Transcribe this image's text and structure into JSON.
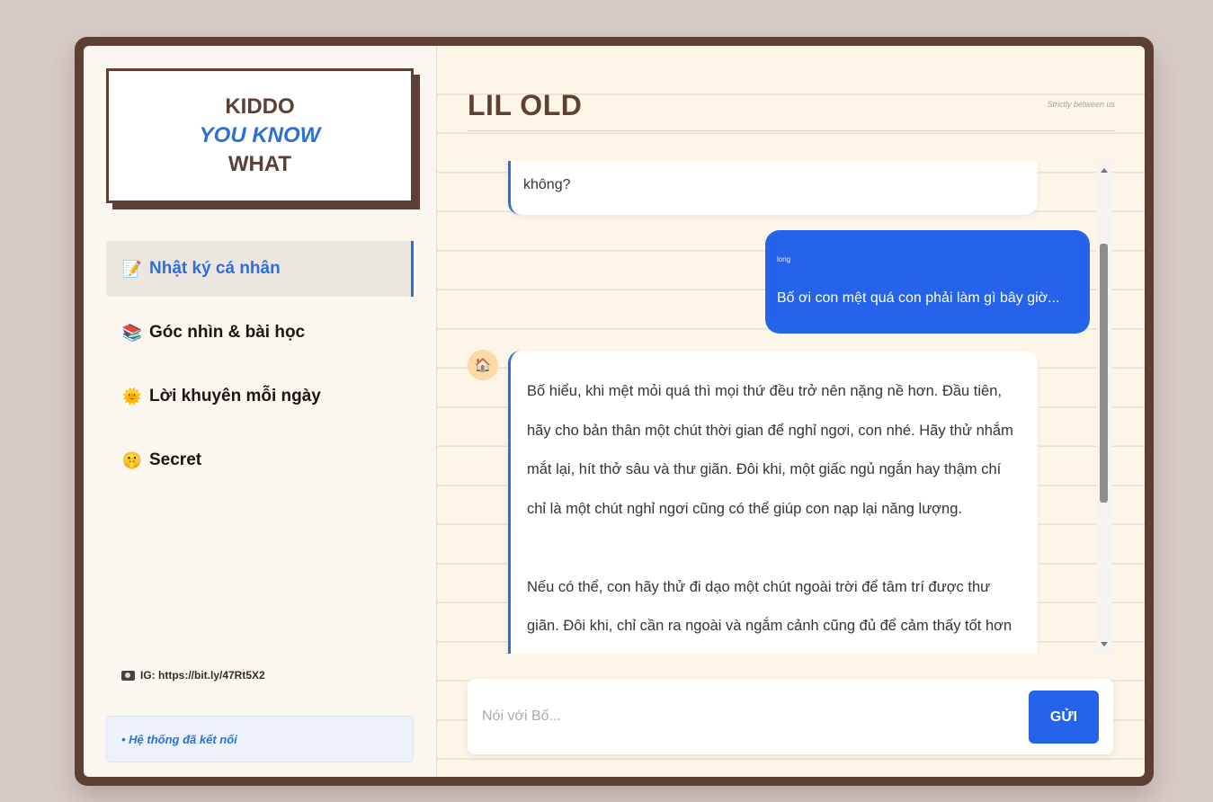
{
  "brand": {
    "line1": "KIDDO",
    "line2": "YOU KNOW",
    "line3": "WHAT"
  },
  "sidebar": {
    "items": [
      {
        "label": "Nhật ký cá nhân",
        "icon": "📝",
        "active": true
      },
      {
        "label": "Góc nhìn & bài học",
        "icon": "📚",
        "active": false
      },
      {
        "label": "Lời khuyên mỗi ngày",
        "icon": "🌞",
        "active": false
      },
      {
        "label": "Secret",
        "icon": "🤫",
        "active": false
      }
    ],
    "ig_label": "IG: https://bit.ly/47Rt5X2",
    "status": "• Hệ thống đã kết nối"
  },
  "header": {
    "title": "LIL OLD",
    "subtitle": "Strictly between us"
  },
  "chat": {
    "messages": [
      {
        "role": "bot",
        "text": "không?"
      },
      {
        "role": "user",
        "meta": "long",
        "text": "Bố ơi con mệt quá con phải làm gì bây giờ..."
      },
      {
        "role": "bot",
        "avatar": "🏠",
        "paragraphs": [
          "Bố hiểu, khi mệt mỏi quá thì mọi thứ đều trở nên nặng nề hơn. Đầu tiên, hãy cho bản thân một chút thời gian để nghỉ ngơi, con nhé. Hãy thử nhắm mắt lại, hít thở sâu và thư giãn. Đôi khi, một giấc ngủ ngắn hay thậm chí chỉ là một chút nghỉ ngơi cũng có thể giúp con nạp lại năng lượng.",
          "Nếu có thể, con hãy thử đi dạo một chút ngoài trời để tâm trí được thư giãn. Đôi khi, chỉ cần ra ngoài và ngắm cảnh cũng đủ để cảm thấy tốt hơn rồi."
        ]
      }
    ]
  },
  "composer": {
    "placeholder": "Nói với Bố...",
    "send_label": "GỬI"
  },
  "colors": {
    "brand_brown": "#5e3f34",
    "accent_blue": "#2563eb",
    "paper": "#fcf5e8"
  }
}
